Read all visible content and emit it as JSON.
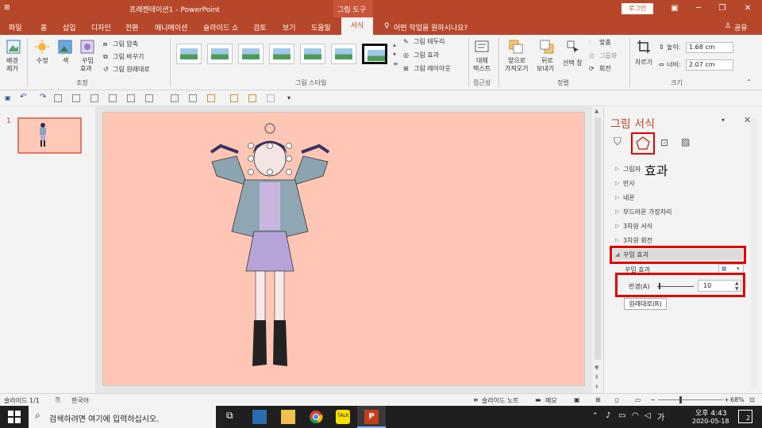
{
  "titlebar": {
    "title": "프레젠테이션1  -  PowerPoint",
    "tool_tab": "그림 도구",
    "login": "로그인"
  },
  "tabs": {
    "items": [
      "파일",
      "홈",
      "삽입",
      "디자인",
      "전환",
      "애니메이션",
      "슬라이드 쇼",
      "검토",
      "보기",
      "도움말",
      "서식"
    ],
    "tell_me": "어떤 작업을 원하시나요?",
    "share": "공유"
  },
  "ribbon": {
    "remove_bg": [
      "배경",
      "제거"
    ],
    "corrections": "수정",
    "color": "색",
    "artistic": [
      "꾸밈",
      "효과"
    ],
    "compress": "그림 압축",
    "change": "그림 바꾸기",
    "reset": "그림 원래대로",
    "adjust_group": "조정",
    "styles_group": "그림 스타일",
    "border": "그림 테두리",
    "effects": "그림 효과",
    "layout": "그림 레이아웃",
    "alt_text": [
      "대체",
      "텍스트"
    ],
    "access_group": "접근성",
    "bring_forward": [
      "앞으로",
      "가져오기"
    ],
    "send_backward": [
      "뒤로",
      "보내기"
    ],
    "selection_pane": "선택 창",
    "align": "맞춤",
    "group": "그룹화",
    "rotate": "회전",
    "arrange_group": "정렬",
    "crop": "자르기",
    "height_label": "높이:",
    "height_value": "1.68 cm",
    "width_label": "너비:",
    "width_value": "2.07 cm",
    "size_group": "크기"
  },
  "thumbs": {
    "slide_number": "1"
  },
  "format_pane": {
    "title": "그림 서식",
    "tooltip": "효과",
    "sections": [
      "그림자",
      "반사",
      "네온",
      "부드러운 가장자리",
      "3차원 서식",
      "3차원 회전"
    ],
    "artistic_section": "꾸밈 효과",
    "artistic_label": "꾸밈 효과",
    "radius_label": "반경(A)",
    "radius_value": "10",
    "reset_button": "원래대로(R)"
  },
  "statusbar": {
    "slide": "슬라이드 1/1",
    "language": "한국어",
    "notes": "슬라이드 노트",
    "comments": "메모",
    "zoom": "68%"
  },
  "taskbar": {
    "search_placeholder": "검색하려면 여기에 입력하십시오.",
    "ime": "가",
    "time": "오후 4:43",
    "date": "2020-05-18",
    "notifications": "2"
  },
  "colors": {
    "accent": "#b7472a",
    "slide_bg": "#ffc6b5",
    "highlight": "#e00000"
  }
}
